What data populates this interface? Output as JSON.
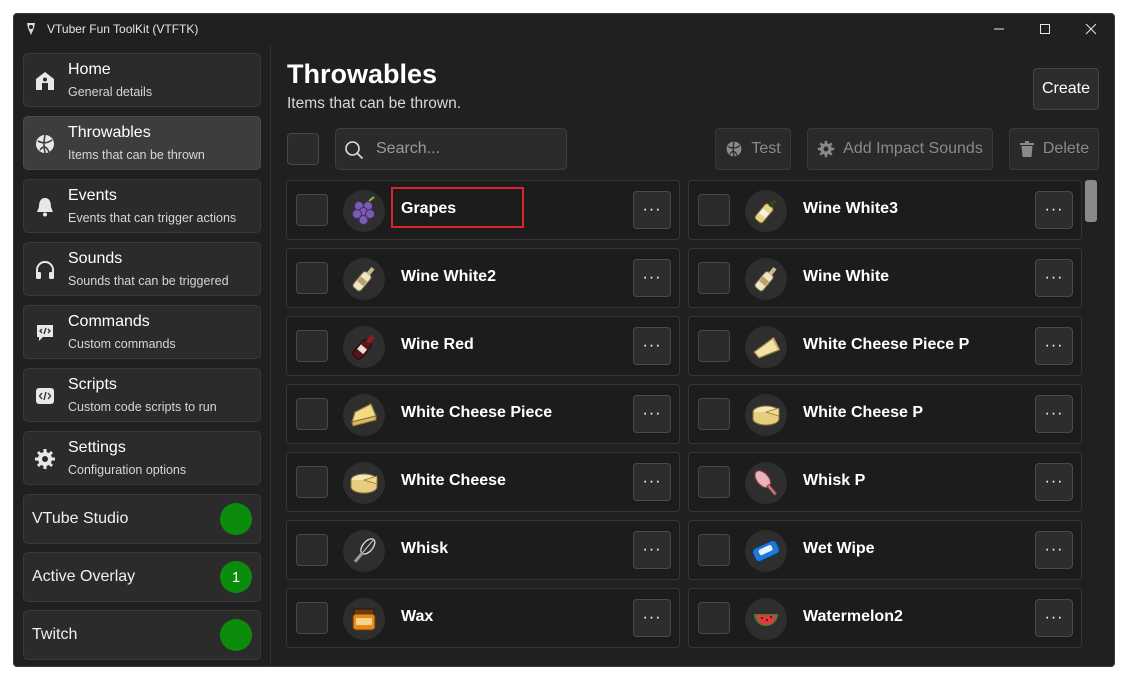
{
  "window": {
    "title": "VTuber Fun ToolKit (VTFTK)"
  },
  "sidebar": {
    "items": [
      {
        "label": "Home",
        "sub": "General details",
        "icon": "home-icon"
      },
      {
        "label": "Throwables",
        "sub": "Items that can be thrown",
        "icon": "throwable-ball-icon"
      },
      {
        "label": "Events",
        "sub": "Events that can trigger actions",
        "icon": "bell-icon"
      },
      {
        "label": "Sounds",
        "sub": "Sounds that can be triggered",
        "icon": "headphones-icon"
      },
      {
        "label": "Commands",
        "sub": "Custom commands",
        "icon": "command-bubble-icon"
      },
      {
        "label": "Scripts",
        "sub": "Custom code scripts to run",
        "icon": "code-icon"
      },
      {
        "label": "Settings",
        "sub": "Configuration options",
        "icon": "gear-icon"
      }
    ],
    "active_index": 1,
    "status": [
      {
        "label": "VTube Studio",
        "badge": "",
        "color": "#0c8c0c"
      },
      {
        "label": "Active Overlay",
        "badge": "1",
        "color": "#0c8c0c"
      },
      {
        "label": "Twitch",
        "badge": "",
        "color": "#0c8c0c"
      }
    ]
  },
  "main": {
    "title": "Throwables",
    "subtitle": "Items that can be thrown.",
    "create_label": "Create",
    "search": {
      "placeholder": "Search...",
      "value": ""
    },
    "test_label": "Test",
    "impact_label": "Add Impact Sounds",
    "delete_label": "Delete",
    "menu_label": "···",
    "items": [
      {
        "name": "Grapes",
        "icon": "grapes-icon"
      },
      {
        "name": "Wine White3",
        "icon": "wine-bottle-white-icon"
      },
      {
        "name": "Wine White2",
        "icon": "wine-bottle-white-icon"
      },
      {
        "name": "Wine White",
        "icon": "wine-bottle-white-icon"
      },
      {
        "name": "Wine Red",
        "icon": "wine-bottle-red-icon"
      },
      {
        "name": "White Cheese Piece P",
        "icon": "cheese-piece-icon"
      },
      {
        "name": "White Cheese Piece",
        "icon": "cheese-piece-icon"
      },
      {
        "name": "White Cheese P",
        "icon": "cheese-wheel-icon"
      },
      {
        "name": "White Cheese",
        "icon": "cheese-wheel-icon"
      },
      {
        "name": "Whisk P",
        "icon": "whisk-pink-icon"
      },
      {
        "name": "Whisk",
        "icon": "whisk-icon"
      },
      {
        "name": "Wet Wipe",
        "icon": "wet-wipe-icon"
      },
      {
        "name": "Wax",
        "icon": "wax-jar-icon"
      },
      {
        "name": "Watermelon2",
        "icon": "watermelon-icon"
      }
    ],
    "highlighted_item": "Grapes"
  },
  "colors": {
    "accent_green": "#0c8c0c",
    "highlight_red": "#d8262c",
    "background": "#202020"
  }
}
